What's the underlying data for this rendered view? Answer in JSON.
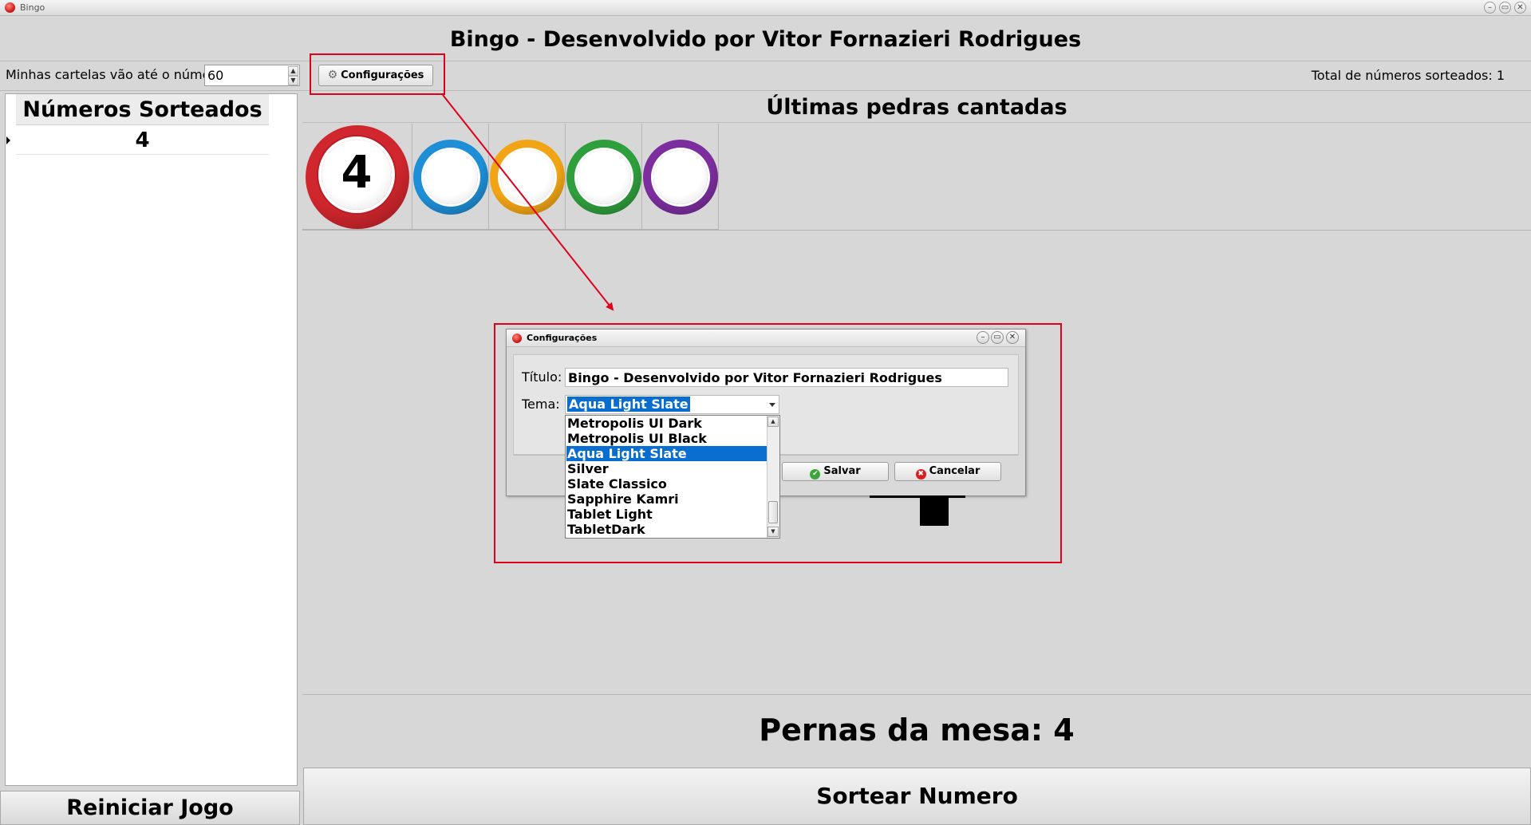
{
  "window": {
    "title": "Bingo",
    "controls": [
      "–",
      "▭",
      "✕"
    ]
  },
  "header": {
    "title": "Bingo - Desenvolvido por Vitor Fornazieri Rodrigues"
  },
  "toolbar": {
    "range_label": "Minhas cartelas vão até o número:",
    "range_value": "60",
    "config_label": "Configurações",
    "total_label": "Total de números sorteados: 1"
  },
  "numbers_panel": {
    "header": "Números Sorteados",
    "rows": [
      "4"
    ],
    "restart_label": "Reiniciar Jogo"
  },
  "recent": {
    "header": "Últimas pedras cantadas",
    "balls": [
      {
        "number": "4",
        "color": "#d0262d"
      },
      {
        "number": "",
        "color": "#1e8fd6"
      },
      {
        "number": "",
        "color": "#f2a514"
      },
      {
        "number": "",
        "color": "#2f9e3c"
      },
      {
        "number": "",
        "color": "#7c2e9e"
      }
    ]
  },
  "legs_label": "Pernas da mesa: 4",
  "draw_label": "Sortear Numero",
  "dialog": {
    "title": "Configurações",
    "titulo_label": "Título:",
    "titulo_value": "Bingo - Desenvolvido por Vitor Fornazieri Rodrigues",
    "tema_label": "Tema:",
    "tema_value": "Aqua Light Slate",
    "save_label": "Salvar",
    "cancel_label": "Cancelar",
    "theme_options": [
      "Metropolis UI Dark",
      "Metropolis UI Black",
      "Aqua Light Slate",
      "Silver",
      "Slate Classico",
      "Sapphire Kamri",
      "Tablet Light",
      "TabletDark"
    ],
    "selected_index": 2
  },
  "colors": {
    "highlight": "#e0001b",
    "selection": "#0a6ed1"
  }
}
